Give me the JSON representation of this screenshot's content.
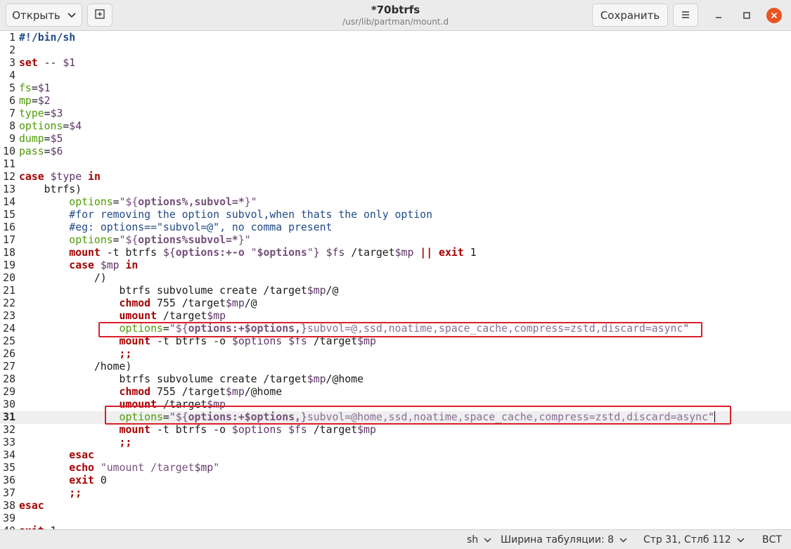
{
  "header": {
    "open_label": "Открыть",
    "save_label": "Сохранить",
    "title": "*70btrfs",
    "subtitle": "/usr/lib/partman/mount.d"
  },
  "editor": {
    "current_line": 31,
    "lines": [
      {
        "n": "1",
        "parts": [
          [
            "sh",
            "#!/bin/sh"
          ]
        ]
      },
      {
        "n": "2",
        "parts": []
      },
      {
        "n": "3",
        "parts": [
          [
            "kw",
            "set"
          ],
          [
            "",
            " -- "
          ],
          [
            "vr",
            "$1"
          ]
        ]
      },
      {
        "n": "4",
        "parts": []
      },
      {
        "n": "5",
        "parts": [
          [
            "nm",
            "fs"
          ],
          [
            "",
            "="
          ],
          [
            "vr",
            "$1"
          ]
        ]
      },
      {
        "n": "6",
        "parts": [
          [
            "nm",
            "mp"
          ],
          [
            "",
            "="
          ],
          [
            "vr",
            "$2"
          ]
        ]
      },
      {
        "n": "7",
        "parts": [
          [
            "nm",
            "type"
          ],
          [
            "",
            "="
          ],
          [
            "vr",
            "$3"
          ]
        ]
      },
      {
        "n": "8",
        "parts": [
          [
            "nm",
            "options"
          ],
          [
            "",
            "="
          ],
          [
            "vr",
            "$4"
          ]
        ]
      },
      {
        "n": "9",
        "parts": [
          [
            "nm",
            "dump"
          ],
          [
            "",
            "="
          ],
          [
            "vr",
            "$5"
          ]
        ]
      },
      {
        "n": "10",
        "parts": [
          [
            "nm",
            "pass"
          ],
          [
            "",
            "="
          ],
          [
            "vr",
            "$6"
          ]
        ]
      },
      {
        "n": "11",
        "parts": []
      },
      {
        "n": "12",
        "parts": [
          [
            "kw",
            "case"
          ],
          [
            "",
            " "
          ],
          [
            "vr",
            "$type"
          ],
          [
            "",
            " "
          ],
          [
            "kw",
            "in"
          ]
        ]
      },
      {
        "n": "13",
        "parts": [
          [
            "",
            "    btrfs)"
          ]
        ]
      },
      {
        "n": "14",
        "parts": [
          [
            "",
            "        "
          ],
          [
            "nm",
            "options"
          ],
          [
            "",
            "="
          ],
          [
            "st",
            "\"${"
          ],
          [
            "vb",
            "options%,subvol=*"
          ],
          [
            "st",
            "}\""
          ]
        ]
      },
      {
        "n": "15",
        "parts": [
          [
            "",
            "        "
          ],
          [
            "cm",
            "#for removing the option subvol,when thats the only option"
          ]
        ]
      },
      {
        "n": "16",
        "parts": [
          [
            "",
            "        "
          ],
          [
            "cm",
            "#eg: options==\"subvol=@\", no comma present"
          ]
        ]
      },
      {
        "n": "17",
        "parts": [
          [
            "",
            "        "
          ],
          [
            "nm",
            "options"
          ],
          [
            "",
            "="
          ],
          [
            "st",
            "\"${"
          ],
          [
            "vb",
            "options%subvol=*"
          ],
          [
            "st",
            "}\""
          ]
        ]
      },
      {
        "n": "18",
        "parts": [
          [
            "",
            "        "
          ],
          [
            "kw",
            "mount"
          ],
          [
            "",
            " -t btrfs "
          ],
          [
            "vr",
            "${"
          ],
          [
            "vb",
            "options:+-o "
          ],
          [
            "st",
            "\""
          ],
          [
            "vb",
            "$options"
          ],
          [
            "st",
            "\""
          ],
          [
            "vr",
            "}"
          ],
          [
            "",
            " "
          ],
          [
            "vr",
            "$fs"
          ],
          [
            "",
            " /target"
          ],
          [
            "vr",
            "$mp"
          ],
          [
            "",
            " "
          ],
          [
            "kw",
            "||"
          ],
          [
            "",
            " "
          ],
          [
            "kw",
            "exit"
          ],
          [
            "",
            " 1"
          ]
        ]
      },
      {
        "n": "19",
        "parts": [
          [
            "",
            "        "
          ],
          [
            "kw",
            "case"
          ],
          [
            "",
            " "
          ],
          [
            "vr",
            "$mp"
          ],
          [
            "",
            " "
          ],
          [
            "kw",
            "in"
          ]
        ]
      },
      {
        "n": "20",
        "parts": [
          [
            "",
            "            /)"
          ]
        ]
      },
      {
        "n": "21",
        "parts": [
          [
            "",
            "                btrfs subvolume create /target"
          ],
          [
            "vr",
            "$mp"
          ],
          [
            "",
            "/@"
          ]
        ]
      },
      {
        "n": "22",
        "parts": [
          [
            "",
            "                "
          ],
          [
            "kw",
            "chmod"
          ],
          [
            "",
            " 755 /target"
          ],
          [
            "vr",
            "$mp"
          ],
          [
            "",
            "/@"
          ]
        ]
      },
      {
        "n": "23",
        "parts": [
          [
            "",
            "                "
          ],
          [
            "kw",
            "umount"
          ],
          [
            "",
            " /target"
          ],
          [
            "vr",
            "$mp"
          ]
        ]
      },
      {
        "n": "24",
        "parts": [
          [
            "",
            "                "
          ],
          [
            "nm",
            "options"
          ],
          [
            "",
            "="
          ],
          [
            "st",
            "\"${"
          ],
          [
            "vb",
            "options:+$options,"
          ],
          [
            "st",
            "}"
          ],
          [
            "fade",
            "subvol=@,ssd,noatime,space_cache,compress=zstd,discard=async"
          ],
          [
            "st",
            "\""
          ]
        ]
      },
      {
        "n": "25",
        "parts": [
          [
            "",
            "                "
          ],
          [
            "kw",
            "mount"
          ],
          [
            "",
            " -t btrfs -o "
          ],
          [
            "vr",
            "$options"
          ],
          [
            "",
            " "
          ],
          [
            "vr",
            "$fs"
          ],
          [
            "",
            " /target"
          ],
          [
            "vr",
            "$mp"
          ]
        ]
      },
      {
        "n": "26",
        "parts": [
          [
            "",
            "                "
          ],
          [
            "kw",
            ";;"
          ]
        ]
      },
      {
        "n": "27",
        "parts": [
          [
            "",
            "            /home)"
          ]
        ]
      },
      {
        "n": "28",
        "parts": [
          [
            "",
            "                btrfs subvolume create /target"
          ],
          [
            "vr",
            "$mp"
          ],
          [
            "",
            "/@home"
          ]
        ]
      },
      {
        "n": "29",
        "parts": [
          [
            "",
            "                "
          ],
          [
            "kw",
            "chmod"
          ],
          [
            "",
            " 755 /target"
          ],
          [
            "vr",
            "$mp"
          ],
          [
            "",
            "/@home"
          ]
        ]
      },
      {
        "n": "30",
        "parts": [
          [
            "",
            "                "
          ],
          [
            "kw",
            "umount"
          ],
          [
            "",
            " /target"
          ],
          [
            "vr",
            "$mp"
          ]
        ]
      },
      {
        "n": "31",
        "parts": [
          [
            "",
            "                "
          ],
          [
            "nm",
            "options"
          ],
          [
            "",
            "="
          ],
          [
            "st",
            "\"${"
          ],
          [
            "vb",
            "options:+$options,"
          ],
          [
            "st",
            "}"
          ],
          [
            "fade",
            "subvol=@home,ssd,noatime,space_cache,compress=zstd,discard=async"
          ],
          [
            "st",
            "\""
          ]
        ]
      },
      {
        "n": "32",
        "parts": [
          [
            "",
            "                "
          ],
          [
            "kw",
            "mount"
          ],
          [
            "",
            " -t btrfs -o "
          ],
          [
            "vr",
            "$options"
          ],
          [
            "",
            " "
          ],
          [
            "vr",
            "$fs"
          ],
          [
            "",
            " /target"
          ],
          [
            "vr",
            "$mp"
          ]
        ]
      },
      {
        "n": "33",
        "parts": [
          [
            "",
            "                "
          ],
          [
            "kw",
            ";;"
          ]
        ]
      },
      {
        "n": "34",
        "parts": [
          [
            "",
            "        "
          ],
          [
            "kw",
            "esac"
          ]
        ]
      },
      {
        "n": "35",
        "parts": [
          [
            "",
            "        "
          ],
          [
            "kw",
            "echo"
          ],
          [
            "",
            " "
          ],
          [
            "st",
            "\"umount /target"
          ],
          [
            "vr",
            "$mp"
          ],
          [
            "st",
            "\""
          ]
        ]
      },
      {
        "n": "36",
        "parts": [
          [
            "",
            "        "
          ],
          [
            "kw",
            "exit"
          ],
          [
            "",
            " 0"
          ]
        ]
      },
      {
        "n": "37",
        "parts": [
          [
            "",
            "        "
          ],
          [
            "kw",
            ";;"
          ]
        ]
      },
      {
        "n": "38",
        "parts": [
          [
            "kw",
            "esac"
          ]
        ]
      },
      {
        "n": "39",
        "parts": []
      },
      {
        "n": "40",
        "parts": [
          [
            "kw",
            "exit"
          ],
          [
            "",
            " 1"
          ]
        ]
      }
    ]
  },
  "statusbar": {
    "language": "sh",
    "tab_width": "Ширина табуляции: 8",
    "position": "Стр 31, Стлб 112",
    "mode": "ВСТ"
  },
  "colors": {
    "highlight_box": "#d8202a",
    "close_button": "#e95420"
  },
  "icons": [
    "chevron-down-icon",
    "new-tab-icon",
    "hamburger-menu-icon",
    "minimize-icon",
    "maximize-icon",
    "close-icon"
  ]
}
